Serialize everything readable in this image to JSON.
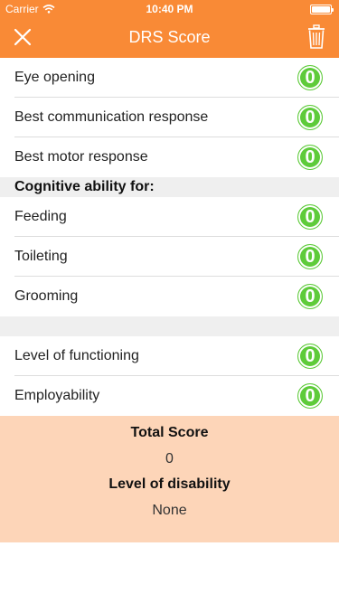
{
  "status_bar": {
    "carrier": "Carrier",
    "time": "10:40 PM",
    "battery_level": 1.0
  },
  "header": {
    "title": "DRS Score"
  },
  "items_group1": [
    {
      "label": "Eye opening",
      "score": "0"
    },
    {
      "label": "Best communication response",
      "score": "0"
    },
    {
      "label": "Best motor response",
      "score": "0"
    }
  ],
  "section": {
    "title": "Cognitive ability for:"
  },
  "items_group2": [
    {
      "label": "Feeding",
      "score": "0"
    },
    {
      "label": "Toileting",
      "score": "0"
    },
    {
      "label": "Grooming",
      "score": "0"
    }
  ],
  "items_group3": [
    {
      "label": "Level of functioning",
      "score": "0"
    },
    {
      "label": "Employability",
      "score": "0"
    }
  ],
  "summary": {
    "total_label": "Total Score",
    "total_value": "0",
    "disability_label": "Level of disability",
    "disability_value": "None"
  },
  "colors": {
    "accent": "#f98a36",
    "badge": "#5ecb3a",
    "summary_bg": "#fdd5b8"
  }
}
